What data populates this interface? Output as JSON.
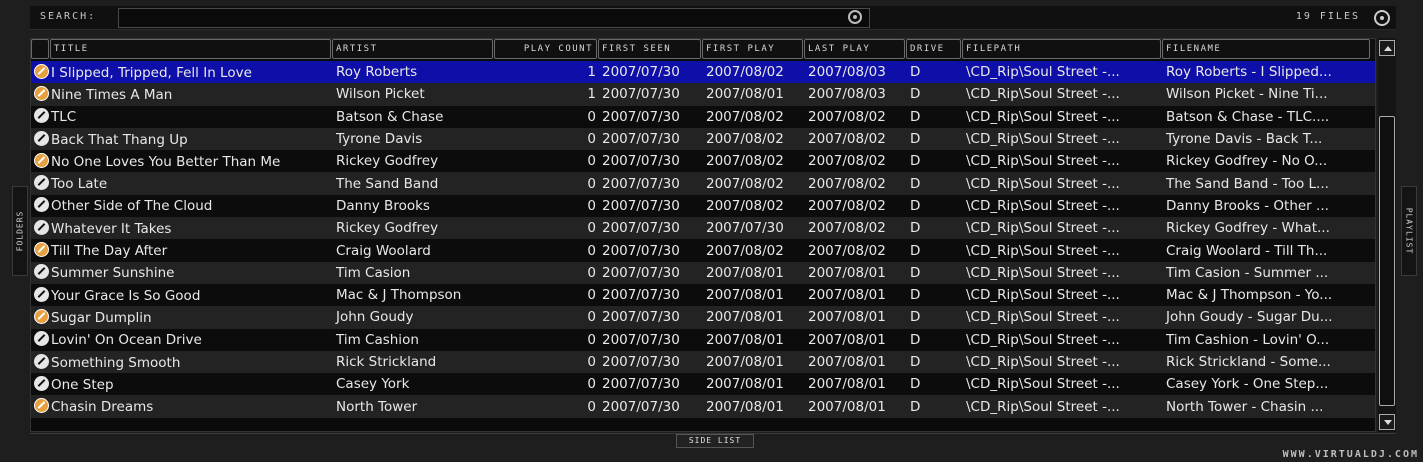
{
  "search": {
    "label": "SEARCH:",
    "value": "",
    "placeholder": ""
  },
  "files_count": "19 FILES",
  "side_tabs": {
    "left": "FOLDERS",
    "right": "PLAYLIST"
  },
  "columns": {
    "title": "TITLE",
    "artist": "ARTIST",
    "play_count": "PLAY COUNT",
    "first_seen": "FIRST SEEN",
    "first_play": "FIRST PLAY",
    "last_play": "LAST PLAY",
    "drive": "DRIVE",
    "filepath": "FILEPATH",
    "filename": "FILENAME"
  },
  "rows": [
    {
      "icon": "playlist-disc-icon",
      "title": "I Slipped, Tripped, Fell In Love",
      "artist": "Roy Roberts",
      "play_count": "1",
      "first_seen": "2007/07/30",
      "first_play": "2007/08/02",
      "last_play": "2007/08/03",
      "drive": "D",
      "filepath": "\\CD_Rip\\Soul Street -...",
      "filename": "Roy Roberts - I Slipped..."
    },
    {
      "icon": "playlist-disc-icon",
      "title": "Nine Times A Man",
      "artist": "Wilson Picket",
      "play_count": "1",
      "first_seen": "2007/07/30",
      "first_play": "2007/08/01",
      "last_play": "2007/08/03",
      "drive": "D",
      "filepath": "\\CD_Rip\\Soul Street -...",
      "filename": "Wilson Picket - Nine Ti..."
    },
    {
      "icon": "cd-icon",
      "title": "TLC",
      "artist": "Batson & Chase",
      "play_count": "0",
      "first_seen": "2007/07/30",
      "first_play": "2007/08/02",
      "last_play": "2007/08/02",
      "drive": "D",
      "filepath": "\\CD_Rip\\Soul Street -...",
      "filename": "Batson & Chase - TLC...."
    },
    {
      "icon": "cd-icon",
      "title": "Back That Thang Up",
      "artist": "Tyrone Davis",
      "play_count": "0",
      "first_seen": "2007/07/30",
      "first_play": "2007/08/02",
      "last_play": "2007/08/02",
      "drive": "D",
      "filepath": "\\CD_Rip\\Soul Street -...",
      "filename": "Tyrone Davis - Back T..."
    },
    {
      "icon": "playlist-disc-icon",
      "title": "No One Loves You Better Than Me",
      "artist": "Rickey Godfrey",
      "play_count": "0",
      "first_seen": "2007/07/30",
      "first_play": "2007/08/02",
      "last_play": "2007/08/02",
      "drive": "D",
      "filepath": "\\CD_Rip\\Soul Street -...",
      "filename": "Rickey Godfrey - No O..."
    },
    {
      "icon": "cd-icon",
      "title": "Too Late",
      "artist": "The Sand Band",
      "play_count": "0",
      "first_seen": "2007/07/30",
      "first_play": "2007/08/02",
      "last_play": "2007/08/02",
      "drive": "D",
      "filepath": "\\CD_Rip\\Soul Street -...",
      "filename": "The Sand Band - Too L..."
    },
    {
      "icon": "cd-icon",
      "title": "Other Side of The Cloud",
      "artist": "Danny Brooks",
      "play_count": "0",
      "first_seen": "2007/07/30",
      "first_play": "2007/08/02",
      "last_play": "2007/08/02",
      "drive": "D",
      "filepath": "\\CD_Rip\\Soul Street -...",
      "filename": "Danny Brooks - Other ..."
    },
    {
      "icon": "cd-icon",
      "title": "Whatever It Takes",
      "artist": "Rickey Godfrey",
      "play_count": "0",
      "first_seen": "2007/07/30",
      "first_play": "2007/07/30",
      "last_play": "2007/08/02",
      "drive": "D",
      "filepath": "\\CD_Rip\\Soul Street -...",
      "filename": "Rickey Godfrey - What..."
    },
    {
      "icon": "playlist-disc-icon",
      "title": "Till The Day After",
      "artist": "Craig Woolard",
      "play_count": "0",
      "first_seen": "2007/07/30",
      "first_play": "2007/08/02",
      "last_play": "2007/08/02",
      "drive": "D",
      "filepath": "\\CD_Rip\\Soul Street -...",
      "filename": "Craig Woolard - Till Th..."
    },
    {
      "icon": "cd-icon",
      "title": "Summer Sunshine",
      "artist": "Tim Casion",
      "play_count": "0",
      "first_seen": "2007/07/30",
      "first_play": "2007/08/01",
      "last_play": "2007/08/01",
      "drive": "D",
      "filepath": "\\CD_Rip\\Soul Street -...",
      "filename": "Tim Casion - Summer ..."
    },
    {
      "icon": "cd-icon",
      "title": "Your Grace Is So Good",
      "artist": "Mac & J Thompson",
      "play_count": "0",
      "first_seen": "2007/07/30",
      "first_play": "2007/08/01",
      "last_play": "2007/08/01",
      "drive": "D",
      "filepath": "\\CD_Rip\\Soul Street -...",
      "filename": "Mac & J Thompson - Yo..."
    },
    {
      "icon": "playlist-disc-icon",
      "title": "Sugar Dumplin",
      "artist": "John Goudy",
      "play_count": "0",
      "first_seen": "2007/07/30",
      "first_play": "2007/08/01",
      "last_play": "2007/08/01",
      "drive": "D",
      "filepath": "\\CD_Rip\\Soul Street -...",
      "filename": "John Goudy - Sugar Du..."
    },
    {
      "icon": "cd-icon",
      "title": "Lovin' On Ocean Drive",
      "artist": "Tim Cashion",
      "play_count": "0",
      "first_seen": "2007/07/30",
      "first_play": "2007/08/01",
      "last_play": "2007/08/01",
      "drive": "D",
      "filepath": "\\CD_Rip\\Soul Street -...",
      "filename": "Tim Cashion - Lovin' O..."
    },
    {
      "icon": "cd-icon",
      "title": "Something Smooth",
      "artist": "Rick Strickland",
      "play_count": "0",
      "first_seen": "2007/07/30",
      "first_play": "2007/08/01",
      "last_play": "2007/08/01",
      "drive": "D",
      "filepath": "\\CD_Rip\\Soul Street -...",
      "filename": "Rick Strickland - Some..."
    },
    {
      "icon": "cd-icon",
      "title": "One Step",
      "artist": "Casey York",
      "play_count": "0",
      "first_seen": "2007/07/30",
      "first_play": "2007/08/01",
      "last_play": "2007/08/01",
      "drive": "D",
      "filepath": "\\CD_Rip\\Soul Street -...",
      "filename": "Casey York - One Step..."
    },
    {
      "icon": "playlist-disc-icon",
      "title": "Chasin Dreams",
      "artist": "North Tower",
      "play_count": "0",
      "first_seen": "2007/07/30",
      "first_play": "2007/08/01",
      "last_play": "2007/08/01",
      "drive": "D",
      "filepath": "\\CD_Rip\\Soul Street -...",
      "filename": "North Tower - Chasin ..."
    }
  ],
  "selected_row": 0,
  "side_list_label": "SIDE LIST",
  "brand": "WWW.VIRTUALDJ.COM",
  "colors": {
    "selection": "#0e0ea8",
    "playlist_icon": "#e6a040"
  }
}
